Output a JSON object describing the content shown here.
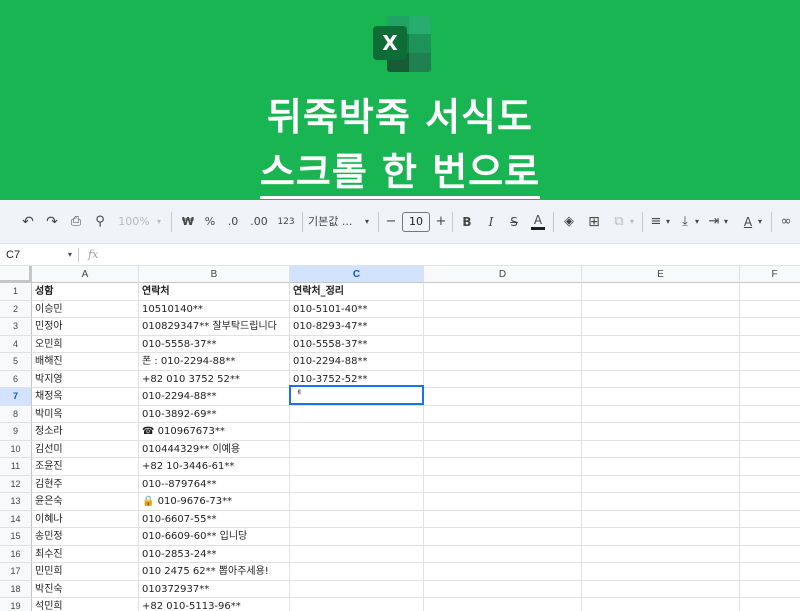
{
  "banner": {
    "logo_letter": "X",
    "line1": "뒤죽박죽 서식도",
    "line2": "스크롤 한 번으로",
    "bg_color": "#1ab553"
  },
  "toolbar": {
    "undo_icon": "↶",
    "redo_icon": "↷",
    "print_icon": "⎙",
    "paint_format_icon": "⚲",
    "zoom": "100%",
    "currency": "₩",
    "percent": "%",
    "dec_less": ".0",
    "dec_more": ".00",
    "number_format": "123",
    "font": "기본값 ...",
    "font_dd": "▾",
    "minus": "−",
    "font_size": "10",
    "plus": "+",
    "bold": "B",
    "italic": "I",
    "strike": "S",
    "text_color": "A",
    "fill_icon": "◈",
    "borders_icon": "⊞",
    "merge_icon": "⧉",
    "align_icon": "≡",
    "valign_icon": "⤓",
    "wrap_icon": "⇥",
    "rotate_icon": "A",
    "link_icon": "∞"
  },
  "formula_bar": {
    "name_box": "C7",
    "name_dd": "▾",
    "fx": "fx",
    "content": ""
  },
  "columns": [
    "A",
    "B",
    "C",
    "D",
    "E",
    "F"
  ],
  "selected_column": "C",
  "rows": [
    {
      "n": "1",
      "a": "성함",
      "b": "연락처",
      "c": "연락처_정리"
    },
    {
      "n": "2",
      "a": "이승민",
      "b": "10510140**",
      "c": "010-5101-40**"
    },
    {
      "n": "3",
      "a": "민정아",
      "b": "010829347** 잘부탁드립니다",
      "c": "010-8293-47**"
    },
    {
      "n": "4",
      "a": "오민희",
      "b": "010-5558-37**",
      "c": "010-5558-37**"
    },
    {
      "n": "5",
      "a": "배해진",
      "b": "폰 : 010-2294-88**",
      "c": "010-2294-88**"
    },
    {
      "n": "6",
      "a": "박지영",
      "b": "+82 010 3752 52**",
      "c": "010-3752-52**"
    },
    {
      "n": "7",
      "a": "채정옥",
      "b": "010-2294-88**",
      "c": ""
    },
    {
      "n": "8",
      "a": "박미옥",
      "b": "010-3892-69**",
      "c": ""
    },
    {
      "n": "9",
      "a": "정소라",
      "b": "☎ 010967673**",
      "c": ""
    },
    {
      "n": "10",
      "a": "김선미",
      "b": "010444329** 이예용",
      "c": ""
    },
    {
      "n": "11",
      "a": "조윤진",
      "b": "+82 10-3446-61**",
      "c": ""
    },
    {
      "n": "12",
      "a": "김현주",
      "b": "010--879764**",
      "c": ""
    },
    {
      "n": "13",
      "a": "윤은숙",
      "b": "🔒 010-9676-73**",
      "c": ""
    },
    {
      "n": "14",
      "a": "이혜나",
      "b": "010-6607-55**",
      "c": ""
    },
    {
      "n": "15",
      "a": "송민정",
      "b": "010-6609-60** 입니당",
      "c": ""
    },
    {
      "n": "16",
      "a": "최수진",
      "b": "010-2853-24**",
      "c": ""
    },
    {
      "n": "17",
      "a": "민민희",
      "b": "010 2475 62** 뽑아주세용!",
      "c": ""
    },
    {
      "n": "18",
      "a": "박진숙",
      "b": "010372937**",
      "c": ""
    },
    {
      "n": "19",
      "a": "석민희",
      "b": "+82 010-5113-96**",
      "c": ""
    }
  ],
  "active_cell": {
    "ref": "C7",
    "content": "ᅦ"
  }
}
